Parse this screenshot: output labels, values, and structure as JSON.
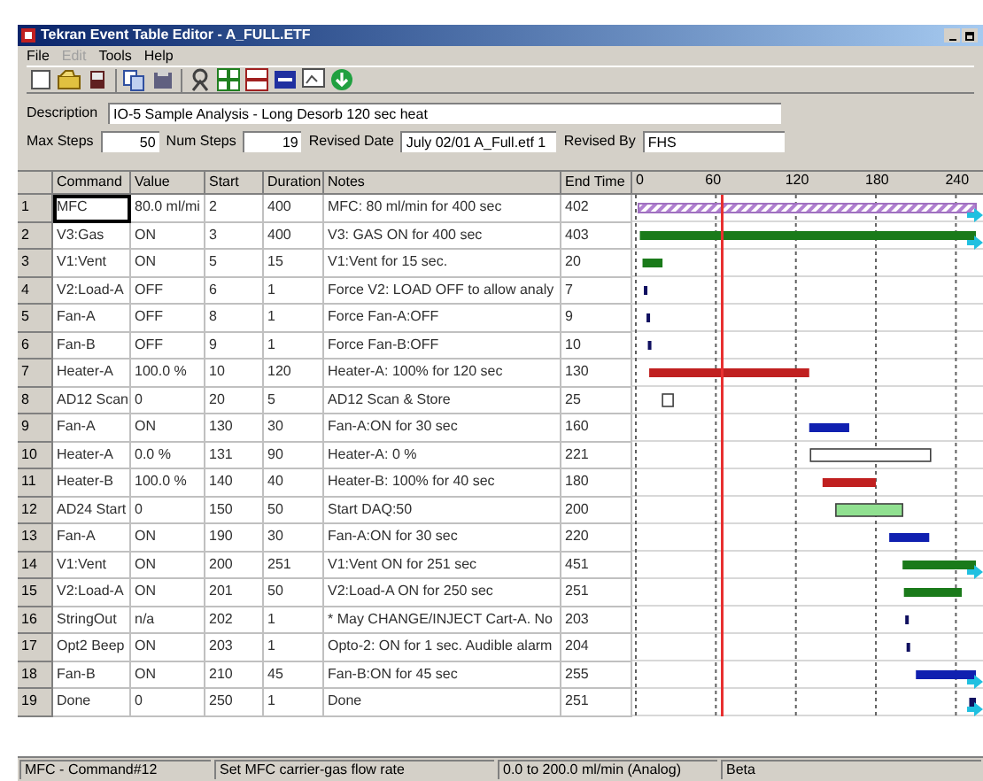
{
  "window": {
    "title": "Tekran Event Table Editor - A_FULL.ETF"
  },
  "menu": [
    {
      "label": "File",
      "disabled": false
    },
    {
      "label": "Edit",
      "disabled": true
    },
    {
      "label": "Tools",
      "disabled": false
    },
    {
      "label": "Help",
      "disabled": false
    }
  ],
  "description": {
    "label": "Description",
    "value": "IO-5 Sample Analysis - Long Desorb 120 sec heat"
  },
  "fields": [
    {
      "label": "Max Steps",
      "value": "50"
    },
    {
      "label": "Num Steps",
      "value": "19"
    },
    {
      "label": "Revised Date",
      "value": "July 02/01 A_Full.etf  1"
    },
    {
      "label": "Revised By",
      "value": "FHS"
    }
  ],
  "table": {
    "columns": [
      "Command",
      "Value",
      "Start",
      "Duration",
      "Notes",
      "End Time"
    ],
    "rows": [
      {
        "number": "1",
        "command": "MFC",
        "value": "80.0 ml/mi",
        "start": "2",
        "duration": "400",
        "notes": "MFC: 80 ml/min for 400 sec",
        "end_time": "402",
        "selected": true,
        "bar": {
          "kind": "hatched",
          "color": "#a070c0",
          "overflow": true
        }
      },
      {
        "number": "2",
        "command": "V3:Gas",
        "value": "ON",
        "start": "3",
        "duration": "400",
        "notes": "V3:  GAS ON for 400 sec",
        "end_time": "403",
        "selected": false,
        "bar": {
          "kind": "solid",
          "color": "#1a7a1a",
          "overflow": true
        }
      },
      {
        "number": "3",
        "command": "V1:Vent",
        "value": "ON",
        "start": "5",
        "duration": "15",
        "notes": "V1:Vent for 15 sec.",
        "end_time": "20",
        "selected": false,
        "bar": {
          "kind": "solid",
          "color": "#1a7a1a",
          "overflow": false
        }
      },
      {
        "number": "4",
        "command": "V2:Load-A",
        "value": "OFF",
        "start": "6",
        "duration": "1",
        "notes": "Force V2: LOAD OFF to allow analy",
        "end_time": "7",
        "selected": false,
        "bar": {
          "kind": "tick",
          "color": "#101060",
          "overflow": false
        }
      },
      {
        "number": "5",
        "command": "Fan-A",
        "value": "OFF",
        "start": "8",
        "duration": "1",
        "notes": "Force Fan-A:OFF",
        "end_time": "9",
        "selected": false,
        "bar": {
          "kind": "tick",
          "color": "#101060",
          "overflow": false
        }
      },
      {
        "number": "6",
        "command": "Fan-B",
        "value": "OFF",
        "start": "9",
        "duration": "1",
        "notes": "Force Fan-B:OFF",
        "end_time": "10",
        "selected": false,
        "bar": {
          "kind": "tick",
          "color": "#101060",
          "overflow": false
        }
      },
      {
        "number": "7",
        "command": "Heater-A",
        "value": "100.0 %",
        "start": "10",
        "duration": "120",
        "notes": "Heater-A: 100% for 120 sec",
        "end_time": "130",
        "selected": false,
        "bar": {
          "kind": "solid",
          "color": "#c02020",
          "overflow": false
        }
      },
      {
        "number": "8",
        "command": "AD12 Scan",
        "value": "0",
        "start": "20",
        "duration": "5",
        "notes": "AD12 Scan & Store",
        "end_time": "25",
        "selected": false,
        "bar": {
          "kind": "outline",
          "color": "#ffffff",
          "overflow": false
        }
      },
      {
        "number": "9",
        "command": "Fan-A",
        "value": "ON",
        "start": "130",
        "duration": "30",
        "notes": "Fan-A:ON for 30 sec",
        "end_time": "160",
        "selected": false,
        "bar": {
          "kind": "solid",
          "color": "#1020b0",
          "overflow": false
        }
      },
      {
        "number": "10",
        "command": "Heater-A",
        "value": "0.0 %",
        "start": "131",
        "duration": "90",
        "notes": "Heater-A: 0 %",
        "end_time": "221",
        "selected": false,
        "bar": {
          "kind": "outline",
          "color": "#ffffff",
          "overflow": false
        }
      },
      {
        "number": "11",
        "command": "Heater-B",
        "value": "100.0 %",
        "start": "140",
        "duration": "40",
        "notes": "Heater-B: 100% for 40 sec",
        "end_time": "180",
        "selected": false,
        "bar": {
          "kind": "solid",
          "color": "#c02020",
          "overflow": false
        }
      },
      {
        "number": "12",
        "command": "AD24 Start",
        "value": "0",
        "start": "150",
        "duration": "50",
        "notes": "Start DAQ:50",
        "end_time": "200",
        "selected": false,
        "bar": {
          "kind": "outline",
          "color": "#90e090",
          "overflow": false
        }
      },
      {
        "number": "13",
        "command": "Fan-A",
        "value": "ON",
        "start": "190",
        "duration": "30",
        "notes": "Fan-A:ON for 30 sec",
        "end_time": "220",
        "selected": false,
        "bar": {
          "kind": "solid",
          "color": "#1020b0",
          "overflow": false
        }
      },
      {
        "number": "14",
        "command": "V1:Vent",
        "value": "ON",
        "start": "200",
        "duration": "251",
        "notes": "V1:Vent ON for 251 sec",
        "end_time": "451",
        "selected": false,
        "bar": {
          "kind": "solid",
          "color": "#1a7a1a",
          "overflow": true
        }
      },
      {
        "number": "15",
        "command": "V2:Load-A",
        "value": "ON",
        "start": "201",
        "duration": "50",
        "notes": "V2:Load-A ON for 250 sec",
        "end_time": "251",
        "selected": false,
        "bar": {
          "kind": "solid",
          "color": "#1a7a1a",
          "overflow": false
        }
      },
      {
        "number": "16",
        "command": "StringOut",
        "value": "n/a",
        "start": "202",
        "duration": "1",
        "notes": "* May CHANGE/INJECT Cart-A. No",
        "end_time": "203",
        "selected": false,
        "bar": {
          "kind": "tick",
          "color": "#101060",
          "overflow": false
        }
      },
      {
        "number": "17",
        "command": "Opt2 Beep",
        "value": "ON",
        "start": "203",
        "duration": "1",
        "notes": "Opto-2: ON for 1 sec. Audible alarm",
        "end_time": "204",
        "selected": false,
        "bar": {
          "kind": "tick",
          "color": "#101060",
          "overflow": false
        }
      },
      {
        "number": "18",
        "command": "Fan-B",
        "value": "ON",
        "start": "210",
        "duration": "45",
        "notes": "Fan-B:ON for 45 sec",
        "end_time": "255",
        "selected": false,
        "bar": {
          "kind": "solid",
          "color": "#1020b0",
          "overflow": true
        }
      },
      {
        "number": "19",
        "command": "Done",
        "value": "0",
        "start": "250",
        "duration": "1",
        "notes": "Done",
        "end_time": "251",
        "selected": false,
        "bar": {
          "kind": "tick",
          "color": "#101060",
          "overflow": true
        }
      }
    ]
  },
  "timeline": {
    "ticks": [
      "0",
      "60",
      "120",
      "180",
      "240"
    ],
    "marker": {
      "level": 0.25
    }
  },
  "status_bar": [
    "MFC - Command#12",
    "Set MFC carrier-gas flow rate",
    "0.0 to 200.0 ml/min (Analog)",
    "Beta"
  ]
}
